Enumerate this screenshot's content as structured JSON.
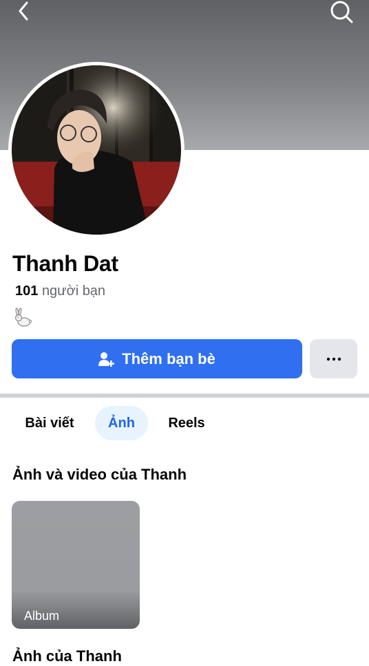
{
  "header": {
    "back_icon": "chevron-left-icon",
    "search_icon": "search-icon"
  },
  "profile": {
    "name": "Thanh Dat",
    "friends_count": "101",
    "friends_label": "người bạn",
    "bio_emoji": "🐇"
  },
  "actions": {
    "add_friend_label": "Thêm bạn bè",
    "add_friend_icon": "person-plus-icon",
    "more_label": "···",
    "accent_color": "#2f6ff0"
  },
  "tabs": [
    {
      "label": "Bài viết",
      "active": false
    },
    {
      "label": "Ảnh",
      "active": true
    },
    {
      "label": "Reels",
      "active": false
    }
  ],
  "sections": {
    "media_title": "Ảnh và video của Thanh",
    "album_label": "Album",
    "photos_title": "Ảnh của Thanh"
  }
}
